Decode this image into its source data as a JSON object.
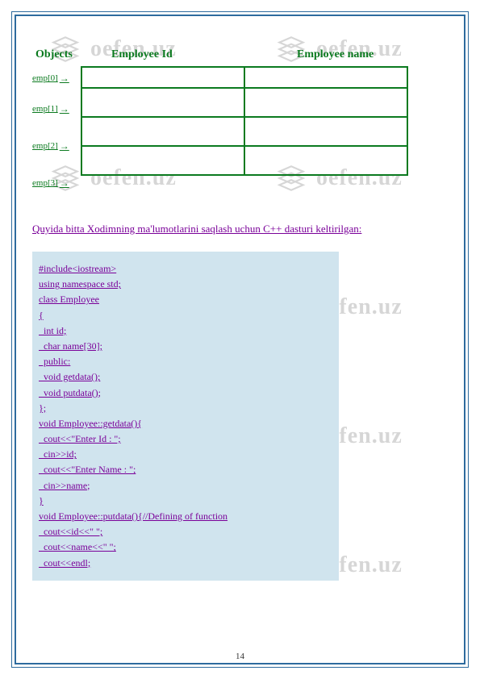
{
  "watermark": "oefen.uz",
  "headers": {
    "objects": "Objects",
    "empid": "Employee Id",
    "empname": "Employee name"
  },
  "rowLabels": [
    "emp[0]",
    "emp[1]",
    "emp[2]",
    "emp[3]"
  ],
  "arrow": "→",
  "caption": "Quyida bitta Xodimning ma'lumotlarini saqlash uchun C++ dasturi keltirilgan:",
  "code": [
    "#include<iostream>",
    "using namespace std;",
    "class Employee",
    "{",
    "  int id;",
    "  char name[30];",
    "  public:",
    "  void getdata();",
    "  void putdata();",
    "};",
    "void Employee::getdata(){",
    "  cout<<\"Enter Id : \";",
    "  cin>>id;",
    "  cout<<\"Enter Name : \";",
    "  cin>>name;",
    "}",
    "void Employee::putdata(){//Defining of function",
    "  cout<<id<<\" \";",
    "  cout<<name<<\" \";",
    "  cout<<endl;"
  ],
  "pageNumber": "14"
}
